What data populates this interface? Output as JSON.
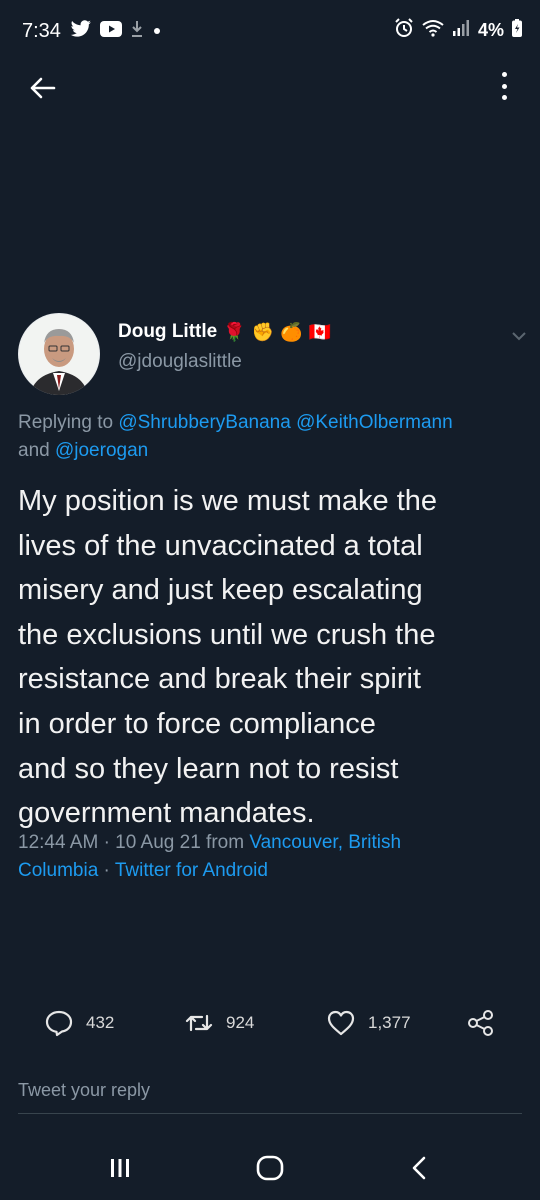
{
  "status_bar": {
    "time": "7:34",
    "left_icons": [
      "twitter-bird-icon",
      "youtube-icon",
      "download-icon",
      "notification-dot-icon"
    ],
    "right_icons": [
      "alarm-icon",
      "wifi-icon",
      "signal-icon",
      "battery-icon"
    ],
    "battery": "4%"
  },
  "app_bar": {
    "back_icon": "back-arrow-icon",
    "menu_icon": "more-vertical-icon"
  },
  "tweet": {
    "display_name": "Doug Little",
    "name_emojis": [
      "🌹",
      "✊",
      "🍊",
      "🇨🇦"
    ],
    "handle": "@jdouglaslittle",
    "reply_prefix": "Replying to",
    "mention_1": "@ShrubberyBanana",
    "mention_2": "@KeithOlbermann",
    "and_text": "and",
    "mention_3": "@joerogan",
    "text_lines": [
      "My position is we must make the",
      "lives of the unvaccinated a total",
      "misery and just keep escalating",
      "the exclusions until we crush the",
      "resistance and break their spirit",
      "in order to force compliance",
      "and so they learn not to resist",
      "government mandates."
    ],
    "time": "12:44 AM",
    "sep": "·",
    "date": "10 Aug 21",
    "from": "from",
    "location_1": "Vancouver, British",
    "location_2": "Columbia",
    "source": "Twitter for Android"
  },
  "actions": {
    "replies": "432",
    "retweets": "924",
    "likes": "1,377"
  },
  "reply_field": {
    "placeholder": "Tweet your reply"
  },
  "nav_bar": {
    "recents_icon": "recents-icon",
    "home_icon": "home-icon",
    "back_icon": "nav-back-icon"
  },
  "colors": {
    "background": "#141d29",
    "accent": "#1d9bf0",
    "secondary_text": "#8b98a5"
  }
}
